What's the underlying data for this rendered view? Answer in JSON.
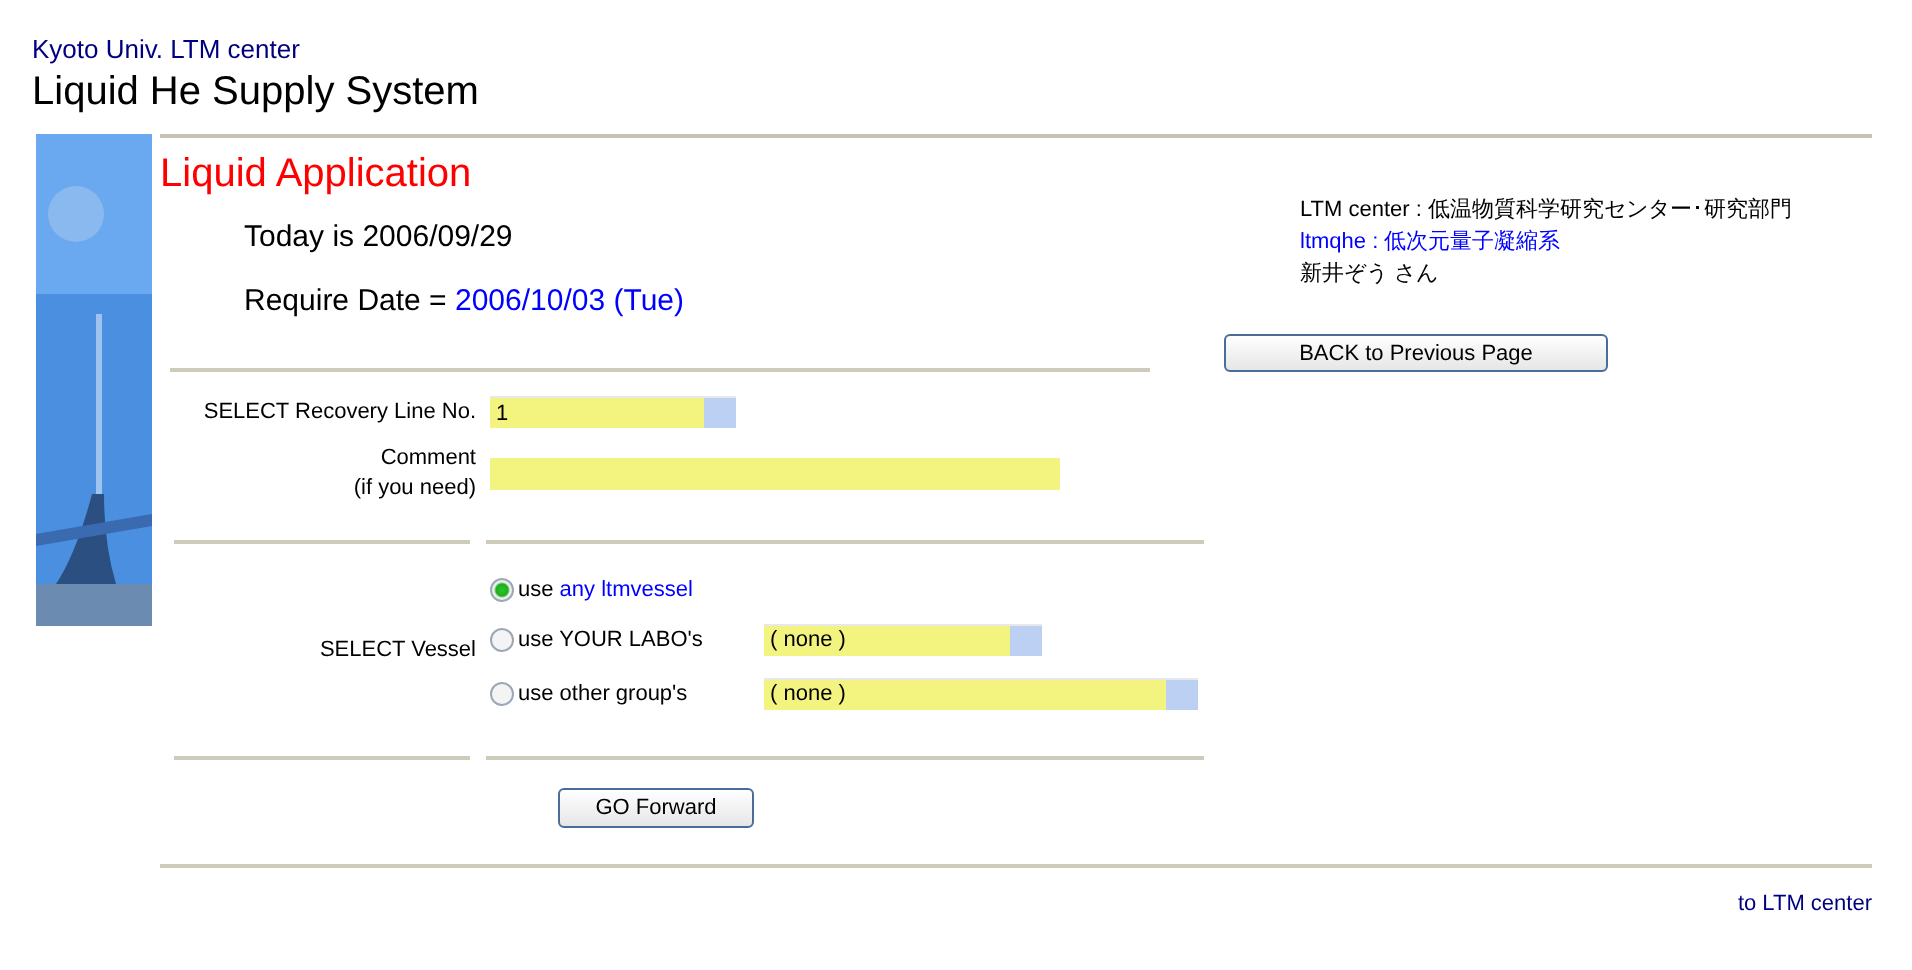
{
  "header": {
    "org": "Kyoto Univ. LTM center",
    "title": "Liquid He Supply System"
  },
  "page_title": "Liquid Application",
  "today": "Today is 2006/09/29",
  "require": {
    "label": "Require Date = ",
    "value": "2006/10/03 (Tue)"
  },
  "user": {
    "center": "LTM center : 低温物質科学研究センター･研究部門",
    "group": "ltmqhe : 低次元量子凝縮系",
    "name": "新井ぞう さん"
  },
  "back_button": "BACK to Previous Page",
  "recovery": {
    "label": "SELECT Recovery Line No.",
    "value": "1"
  },
  "comment": {
    "label": [
      "Comment",
      "(if you need)"
    ]
  },
  "vessel": {
    "label": "SELECT Vessel",
    "options": [
      {
        "kind": "link",
        "prefix": "use ",
        "link": "any ltmvessel",
        "selected": true
      },
      {
        "kind": "select",
        "text": "use YOUR LABO's",
        "value": "( none )",
        "selected": false
      },
      {
        "kind": "select_wide",
        "text": "use other group's",
        "value": "( none )",
        "selected": false
      }
    ]
  },
  "forward_button": "GO Forward",
  "footer_link": "to LTM center"
}
